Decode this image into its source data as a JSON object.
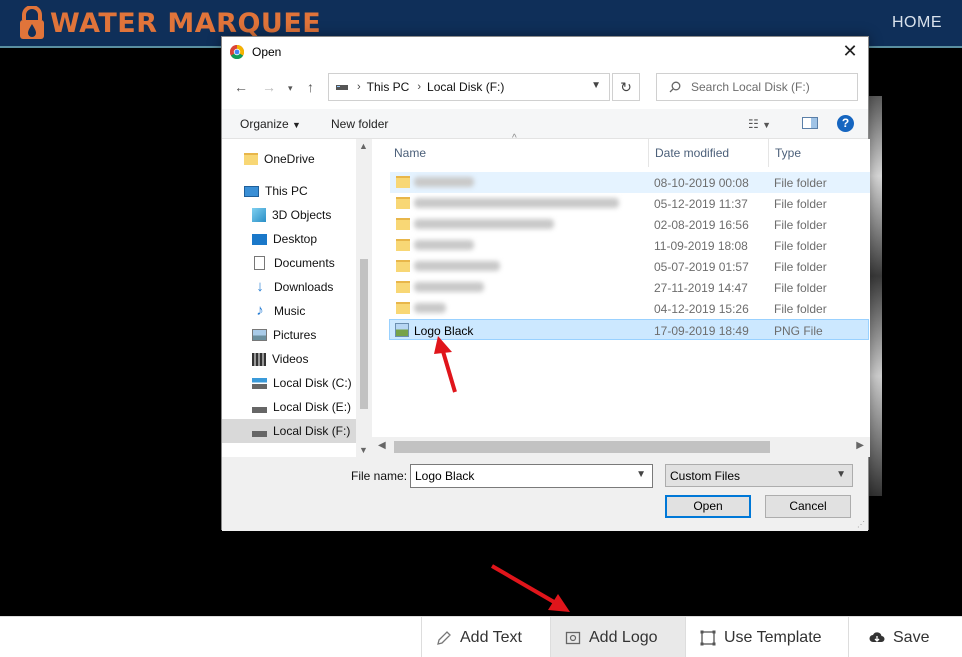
{
  "app": {
    "brand": "WATER MARQUEE",
    "nav_home": "HOME"
  },
  "dialog": {
    "title": "Open",
    "breadcrumb": [
      "This PC",
      "Local Disk (F:)"
    ],
    "search_placeholder": "Search Local Disk (F:)",
    "commands": {
      "organize": "Organize",
      "new_folder": "New folder"
    },
    "nav_items": [
      {
        "label": "OneDrive",
        "icon": "onedrive-folder-icon"
      },
      {
        "label": "This PC",
        "icon": "computer-icon"
      },
      {
        "label": "3D Objects",
        "icon": "3d-objects-icon"
      },
      {
        "label": "Desktop",
        "icon": "desktop-icon"
      },
      {
        "label": "Documents",
        "icon": "documents-icon"
      },
      {
        "label": "Downloads",
        "icon": "downloads-icon"
      },
      {
        "label": "Music",
        "icon": "music-icon"
      },
      {
        "label": "Pictures",
        "icon": "pictures-icon"
      },
      {
        "label": "Videos",
        "icon": "videos-icon"
      },
      {
        "label": "Local Disk (C:)",
        "icon": "drive-icon"
      },
      {
        "label": "Local Disk (E:)",
        "icon": "drive-icon"
      },
      {
        "label": "Local Disk (F:)",
        "icon": "drive-icon"
      }
    ],
    "columns": {
      "name": "Name",
      "date_modified": "Date modified",
      "type": "Type"
    },
    "files": [
      {
        "name": "",
        "date": "08-10-2019 00:08",
        "type": "File folder"
      },
      {
        "name": "",
        "date": "05-12-2019 11:37",
        "type": "File folder"
      },
      {
        "name": "",
        "date": "02-08-2019 16:56",
        "type": "File folder"
      },
      {
        "name": "",
        "date": "11-09-2019 18:08",
        "type": "File folder"
      },
      {
        "name": "",
        "date": "05-07-2019 01:57",
        "type": "File folder"
      },
      {
        "name": "",
        "date": "27-11-2019 14:47",
        "type": "File folder"
      },
      {
        "name": "",
        "date": "04-12-2019 15:26",
        "type": "File folder"
      },
      {
        "name": "Logo Black",
        "date": "17-09-2019 18:49",
        "type": "PNG File"
      }
    ],
    "file_name_label": "File name:",
    "file_name_value": "Logo Black",
    "file_type_value": "Custom Files",
    "open_button": "Open",
    "cancel_button": "Cancel"
  },
  "toolbar": {
    "add_text": "Add Text",
    "add_logo": "Add Logo",
    "use_template": "Use Template",
    "save": "Save"
  },
  "colors": {
    "topbar": "#0f2f59",
    "brand": "#e0743a",
    "arrow": "#e0151b",
    "selection": "#cce8ff"
  }
}
